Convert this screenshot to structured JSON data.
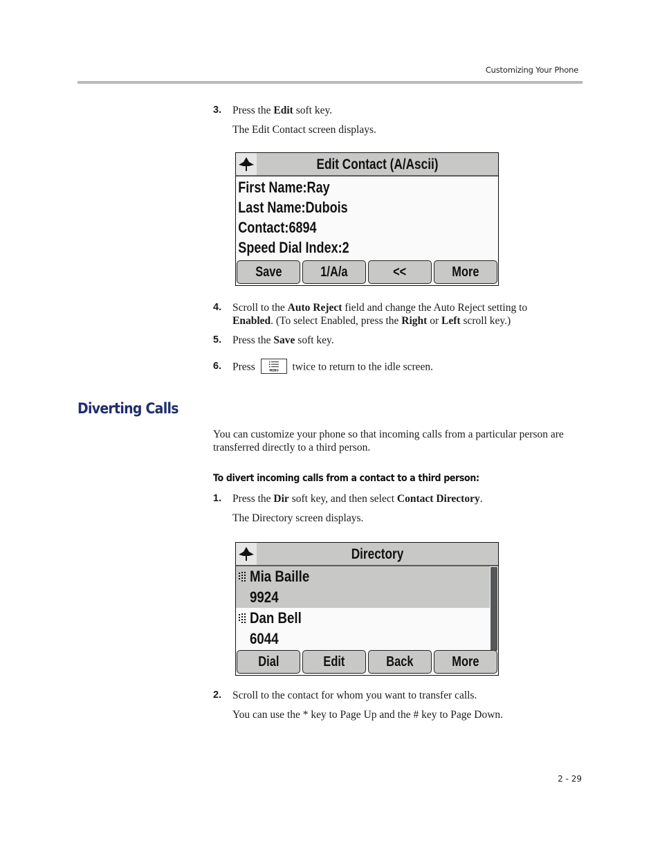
{
  "header": {
    "running_title": "Customizing Your Phone"
  },
  "steps_top": [
    {
      "num": "3.",
      "parts": [
        [
          "Press the ",
          false
        ],
        [
          "Edit",
          true
        ],
        [
          " soft key.",
          false
        ]
      ]
    },
    {
      "num": "4.",
      "parts": [
        [
          "Scroll to the ",
          false
        ],
        [
          "Auto Reject",
          true
        ],
        [
          " field and change the Auto Reject setting to ",
          false
        ],
        [
          "Enabled",
          true
        ],
        [
          ". (To select Enabled, press the ",
          false
        ],
        [
          "Right",
          true
        ],
        [
          " or ",
          false
        ],
        [
          "Left",
          true
        ],
        [
          " scroll key.)",
          false
        ]
      ]
    },
    {
      "num": "5.",
      "parts": [
        [
          "Press the ",
          false
        ],
        [
          "Save",
          true
        ],
        [
          " soft key.",
          false
        ]
      ]
    },
    {
      "num": "6.",
      "before": "Press",
      "after": "twice to return to the idle screen.",
      "key_icon": "menu-key-icon",
      "key_label": "MENU"
    }
  ],
  "edit_contact_caption": "The Edit Contact screen displays.",
  "edit_contact_screen": {
    "title": "Edit Contact (A/Ascii)",
    "nav_icon": "navigation-arrow-icon",
    "fields": [
      {
        "label": "First Name:",
        "value": "Ray"
      },
      {
        "label": "Last Name:",
        "value": "Dubois"
      },
      {
        "label": "Contact:",
        "value": "6894"
      },
      {
        "label": "Speed Dial Index:",
        "value": "2"
      }
    ],
    "softkeys": [
      "Save",
      "1/A/a",
      "<<",
      "More"
    ]
  },
  "section": {
    "heading": "Diverting Calls",
    "intro": "You can customize your phone so that incoming calls from a particular person are transferred directly to a third person.",
    "procedure_heading": "To divert incoming calls from a contact to a third person:",
    "step1": {
      "num": "1.",
      "parts": [
        [
          "Press the ",
          false
        ],
        [
          "Dir",
          true
        ],
        [
          " soft key, and then select ",
          false
        ],
        [
          "Contact Directory",
          true
        ],
        [
          ".",
          false
        ]
      ]
    },
    "directory_caption": "The Directory screen displays.",
    "step2": {
      "num": "2.",
      "text": "Scroll to the contact for whom you want to transfer calls."
    },
    "step2_note": "You can use the * key to Page Up and the # key to Page Down."
  },
  "directory_screen": {
    "title": "Directory",
    "nav_icon": "navigation-arrow-icon",
    "entries": [
      {
        "name": "Mia Baille",
        "number": "9924",
        "selected": true
      },
      {
        "name": "Dan Bell",
        "number": "6044",
        "selected": false
      }
    ],
    "softkeys": [
      "Dial",
      "Edit",
      "Back",
      "More"
    ]
  },
  "footer": {
    "page_number": "2 - 29"
  },
  "colors": {
    "heading": "#1f2f6e",
    "rule": "#b9b9b9",
    "lcd_bar": "#c8c8c6",
    "scrollbar": "#555759"
  }
}
